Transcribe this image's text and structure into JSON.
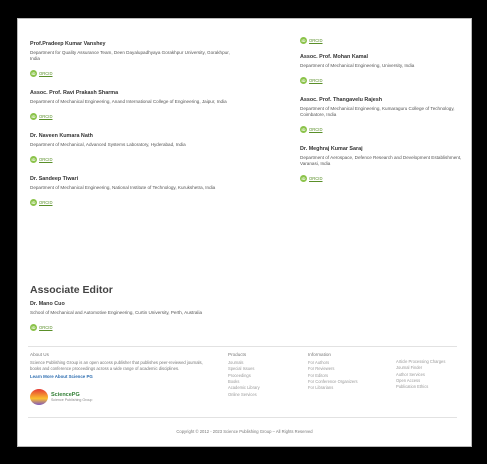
{
  "left_editors": [
    {
      "name": "Prof.Pradeep Kumar Vanshey",
      "affiliation": "Department for Quality Assurance Team, Deen Dayalupadhyaya Gorakhpur University, Gorakhpur, India",
      "orcid": "ORCID"
    },
    {
      "name": "Assoc. Prof. Ravi Prakash Sharma",
      "affiliation": "Department of Mechanical Engineering, Anand International College of Engineering, Jaipur, India",
      "orcid": "ORCID"
    },
    {
      "name": "Dr. Naveen Kumara Nath",
      "affiliation": "Department of Mechanical, Advanced Systems Laboratory, Hyderabad, India",
      "orcid": "ORCID"
    },
    {
      "name": "Dr. Sandeep Tiwari",
      "affiliation": "Department of Mechanical Engineering, National Institute of Technology, Kurukshetra, India",
      "orcid": "ORCID"
    }
  ],
  "right_top_orcid": "ORCID",
  "right_editors": [
    {
      "name": "Assoc. Prof. Mohan Kamal",
      "affiliation": "Department of Mechanical Engineering, University, India",
      "orcid": "ORCID"
    },
    {
      "name": "Assoc. Prof. Thangavelu Rajesh",
      "affiliation": "Department of Mechanical Engineering, Kumaraguru College of Technology, Coimbatore, India",
      "orcid": "ORCID"
    },
    {
      "name": "Dr. Meghraj Kumar Saraj",
      "affiliation": "Department of Aerospace, Defence Research and Development Establishment, Varanasi, India",
      "orcid": "ORCID"
    }
  ],
  "associate_title": "Associate Editor",
  "associate": {
    "name": "Dr. Mano Cuo",
    "affiliation": "School of Mechanical and Automotive Engineering, Curtin University, Perth, Australia",
    "orcid": "ORCID"
  },
  "footer": {
    "about_head": "About Us",
    "about_text": "Science Publishing Group is an open access publisher that publishes peer-reviewed journals, books and conference proceedings across a wide range of academic disciplines.",
    "learn_more": "Learn More About Science PG",
    "logo_text": "SciencePG",
    "logo_sub": "Science Publishing Group",
    "col2_head": "Products",
    "col2_links": [
      "Journals",
      "Special Issues",
      "Proceedings",
      "Books",
      "Academic Library",
      "Online Services"
    ],
    "col3_head": "Information",
    "col3_links": [
      "For Authors",
      "For Reviewers",
      "For Editors",
      "For Conference Organizers",
      "For Librarians"
    ],
    "col4_links": [
      "Article Processing Charges",
      "Journal Finder",
      "Author Services",
      "Open Access",
      "Publication Ethics"
    ],
    "copyright": "Copyright © 2012 - 2023 Science Publishing Group – All Rights Reserved"
  }
}
